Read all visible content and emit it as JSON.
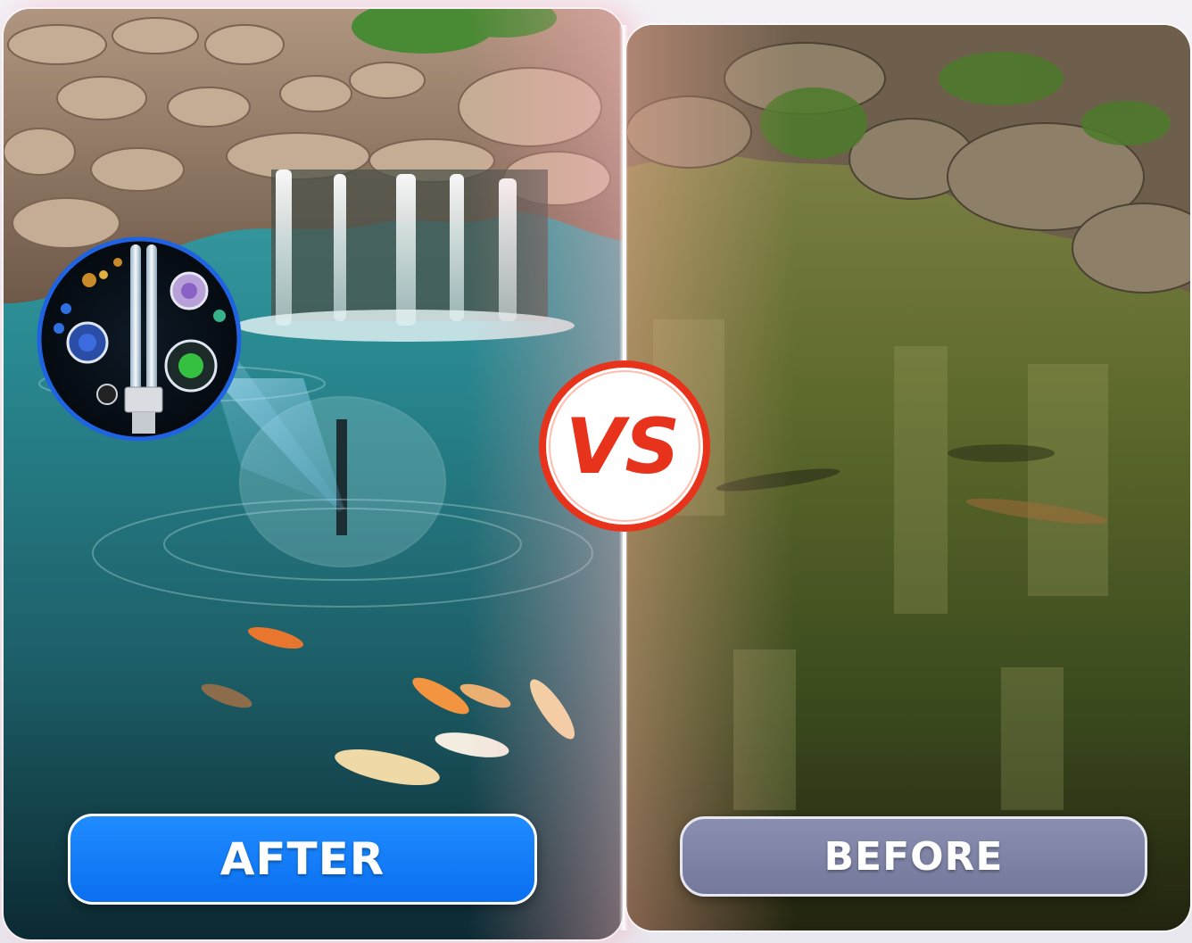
{
  "scene": {
    "after_label": "AFTER",
    "before_label": "BEFORE",
    "vs_text": "VS",
    "inset_icon": "uv-lamp-with-microbes",
    "colors": {
      "after_button": "#1a86ff",
      "before_button": "#8085a8",
      "vs_ring": "#e8331c",
      "clear_water": "#2c7d85",
      "murky_water": "#6b6a2a"
    }
  }
}
